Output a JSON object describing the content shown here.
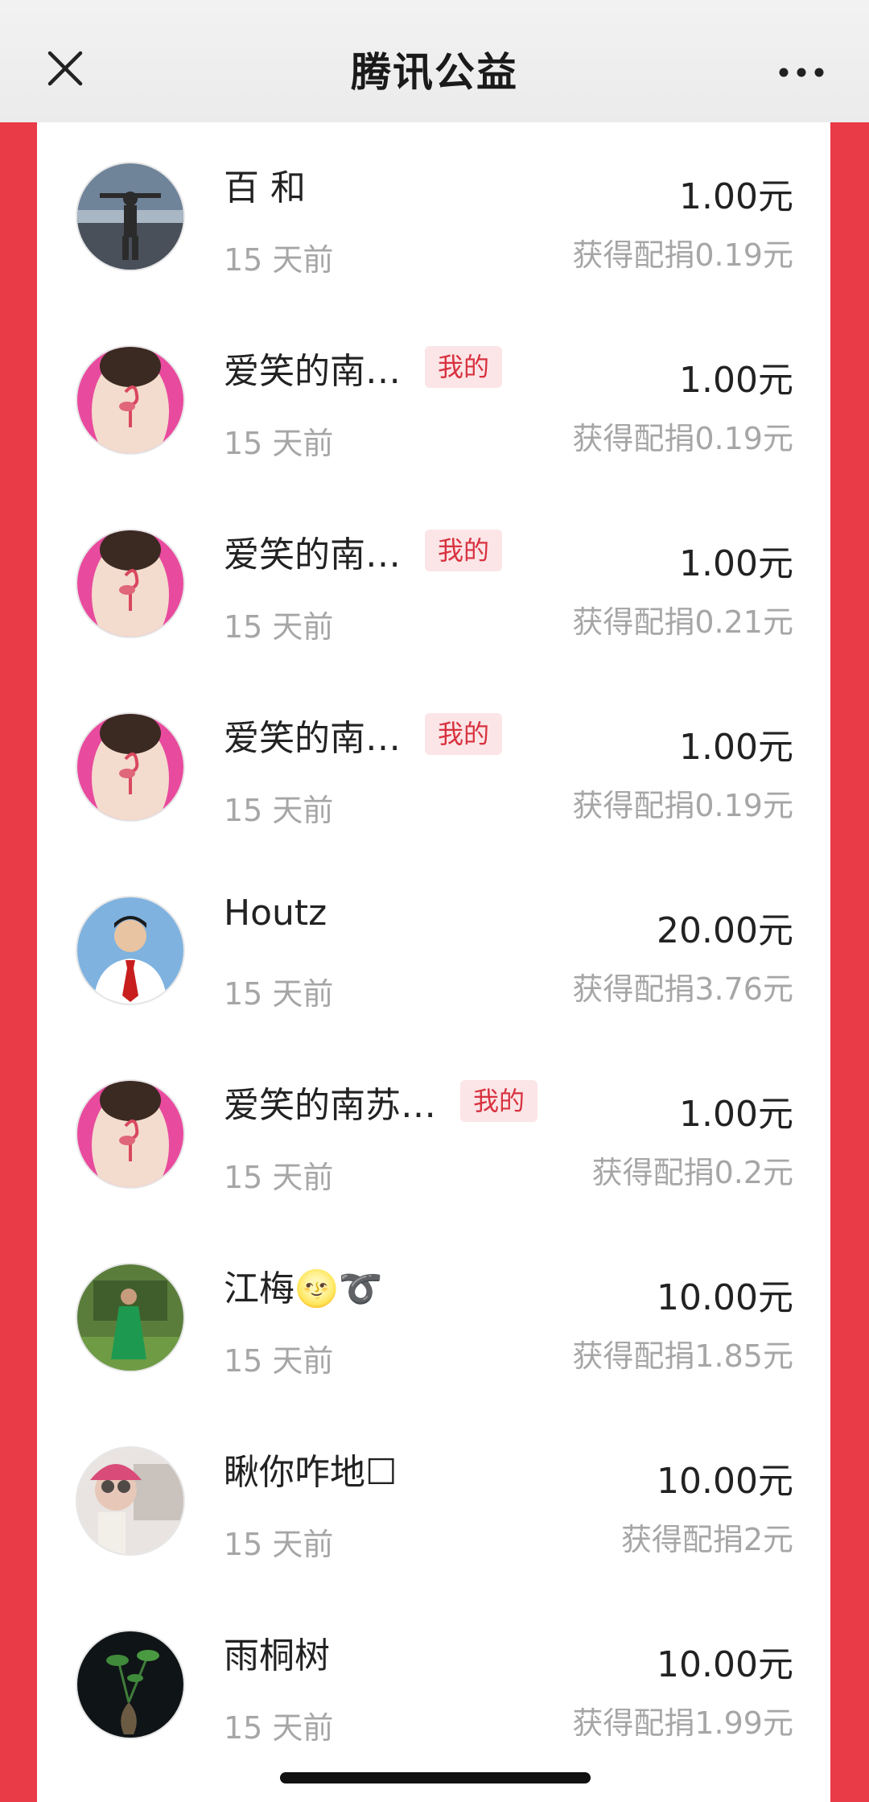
{
  "header": {
    "title": "腾讯公益",
    "close_icon": "close-icon",
    "more_icon": "more-dots-icon"
  },
  "colors": {
    "accent_red": "#e93a48",
    "badge_bg": "#fbe5e7",
    "badge_text": "#d8323f",
    "muted_text": "#a6a6a6"
  },
  "donations": [
    {
      "name": "百 和",
      "mine": false,
      "time": "15 天前",
      "amount": "1.00元",
      "match": "获得配捐0.19元",
      "avatar": "person-silhouette-avatar"
    },
    {
      "name": "爱笑的南…",
      "mine": true,
      "badge": "我的",
      "time": "15 天前",
      "amount": "1.00元",
      "match": "获得配捐0.19元",
      "avatar": "flamingo-tattoo-avatar"
    },
    {
      "name": "爱笑的南…",
      "mine": true,
      "badge": "我的",
      "time": "15 天前",
      "amount": "1.00元",
      "match": "获得配捐0.21元",
      "avatar": "flamingo-tattoo-avatar"
    },
    {
      "name": "爱笑的南…",
      "mine": true,
      "badge": "我的",
      "time": "15 天前",
      "amount": "1.00元",
      "match": "获得配捐0.19元",
      "avatar": "flamingo-tattoo-avatar"
    },
    {
      "name": "Houtz",
      "mine": false,
      "time": "15 天前",
      "amount": "20.00元",
      "match": "获得配捐3.76元",
      "avatar": "portrait-tie-avatar"
    },
    {
      "name": "爱笑的南苏…",
      "mine": true,
      "badge": "我的",
      "time": "15 天前",
      "amount": "1.00元",
      "match": "获得配捐0.2元",
      "avatar": "flamingo-tattoo-avatar"
    },
    {
      "name": "江梅🌝➰",
      "mine": false,
      "time": "15 天前",
      "amount": "10.00元",
      "match": "获得配捐1.85元",
      "avatar": "green-dress-avatar"
    },
    {
      "name": "瞅你咋地☐",
      "mine": false,
      "time": "15 天前",
      "amount": "10.00元",
      "match": "获得配捐2元",
      "avatar": "selfie-avatar"
    },
    {
      "name": "雨桐树",
      "mine": false,
      "time": "15 天前",
      "amount": "10.00元",
      "match": "获得配捐1.99元",
      "avatar": "plant-vase-avatar"
    }
  ]
}
